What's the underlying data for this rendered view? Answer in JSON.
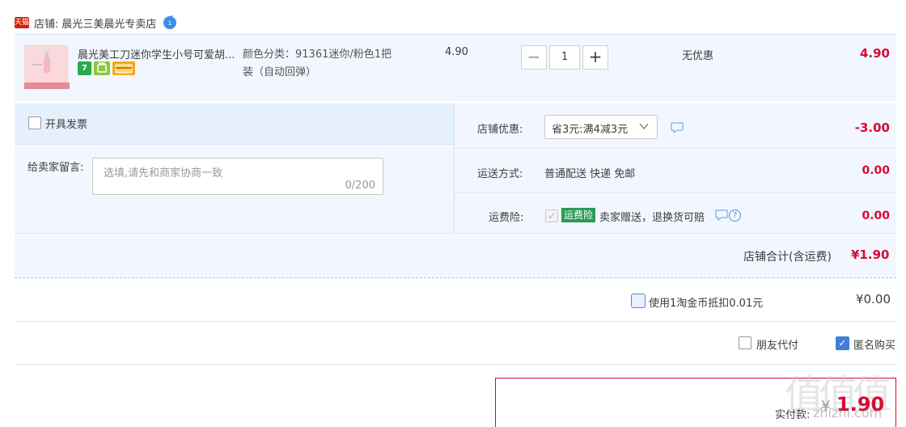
{
  "shop": {
    "platform_badge": "天猫",
    "prefix": "店铺:",
    "name": "晨光三美晨光专卖店",
    "chat_badge_count": "1"
  },
  "item": {
    "title": "晨光美工刀迷你学生小号可爱胡...",
    "sku_line1": "颜色分类：91361迷你/粉色1把",
    "sku_line2": "装（自动回弹）",
    "unit_price": "4.90",
    "quantity": "1",
    "qty_minus": "−",
    "qty_plus": "+",
    "discount": "无优惠",
    "line_total": "4.90",
    "badges": [
      "7",
      "",
      ""
    ]
  },
  "options": {
    "invoice_label": "开具发票",
    "message_label": "给卖家留言:",
    "message_placeholder": "选填,请先和商家协商一致",
    "message_count": "0/200",
    "coupon_label": "店铺优惠:",
    "coupon_value": "省3元:满4减3元",
    "coupon_amount": "-3.00",
    "shipping_label": "运送方式:",
    "shipping_value": "普通配送 快递 免邮",
    "shipping_amount": "0.00",
    "insurance_label": "运费险:",
    "insurance_tag": "运费险",
    "insurance_desc": "卖家赠送，退换货可赔",
    "insurance_amount": "0.00",
    "store_total_label": "店铺合计(含运费)",
    "store_total_value": "¥1.90"
  },
  "coins": {
    "label": "使用1淘金币抵扣0.01元",
    "amount": "¥0.00"
  },
  "payment_opts": {
    "friend_pay": "朋友代付",
    "anonymous": "匿名购买",
    "anonymous_checked": true
  },
  "pay": {
    "label": "实付款:",
    "currency": "¥",
    "amount": "1.90"
  },
  "watermark": {
    "site": "zhizhi.com"
  },
  "colors": {
    "accent_red": "#d70a34",
    "panel_bg": "#f2f7ff",
    "check_blue": "#3f7fd8",
    "insurance_green": "#2d9a58"
  }
}
